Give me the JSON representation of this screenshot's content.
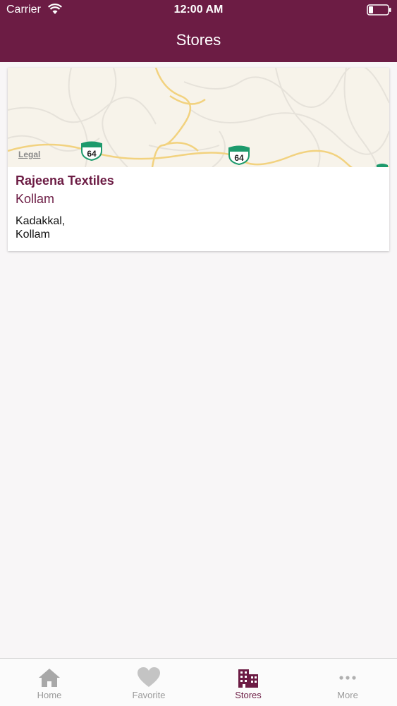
{
  "status_bar": {
    "carrier": "Carrier",
    "time": "12:00 AM"
  },
  "header": {
    "title": "Stores"
  },
  "stores": [
    {
      "name": "Rajeena Textiles",
      "city": "Kollam",
      "address_line1": "Kadakkal,",
      "address_line2": "Kollam",
      "map": {
        "legal_label": "Legal",
        "highway_shield_1": "64",
        "highway_shield_2": "64"
      }
    }
  ],
  "tab_bar": {
    "items": [
      {
        "label": "Home",
        "icon": "home-icon",
        "active": false
      },
      {
        "label": "Favorite",
        "icon": "heart-icon",
        "active": false
      },
      {
        "label": "Stores",
        "icon": "building-icon",
        "active": true
      },
      {
        "label": "More",
        "icon": "more-dots-icon",
        "active": false
      }
    ]
  },
  "colors": {
    "brand": "#6c1c44",
    "tab_inactive": "#9a9a9a",
    "background": "#f8f6f7",
    "map_road_major": "#f2d27f",
    "map_highway_shield": "#1d9a6c"
  }
}
